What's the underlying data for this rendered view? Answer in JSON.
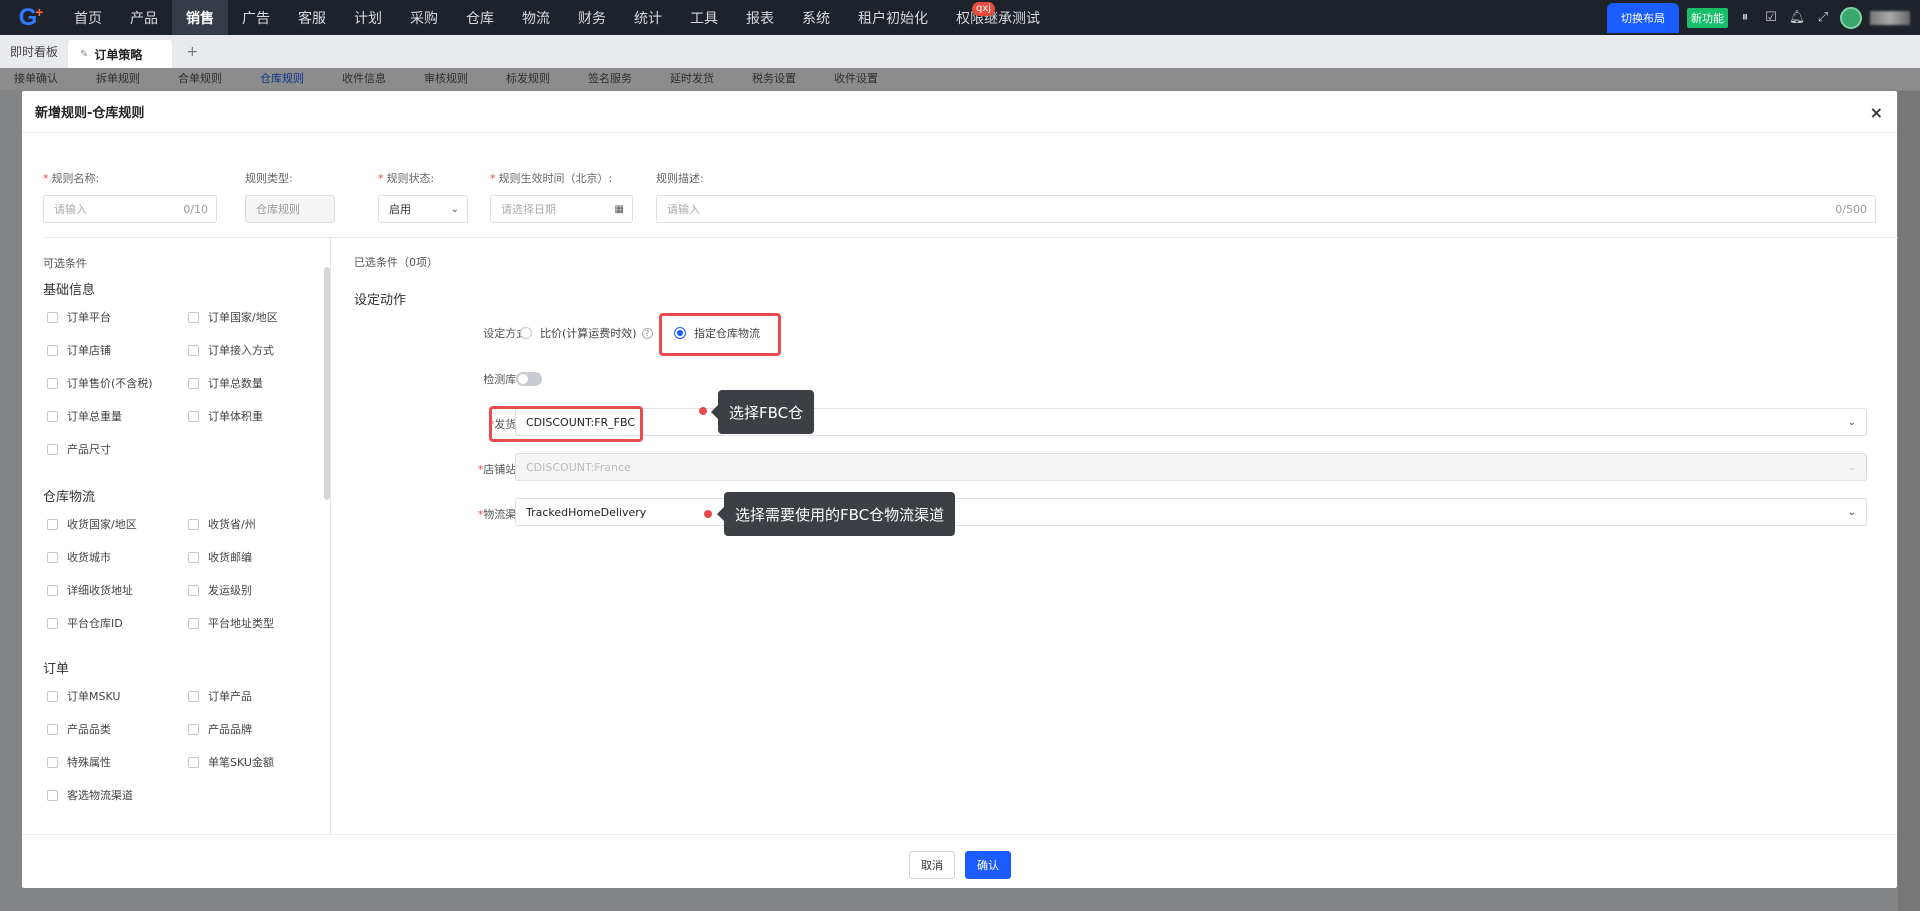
{
  "top_nav": {
    "items": [
      "首页",
      "产品",
      "销售",
      "广告",
      "客服",
      "计划",
      "采购",
      "仓库",
      "物流",
      "财务",
      "统计",
      "工具",
      "报表",
      "系统",
      "租户初始化",
      "权限继承测试"
    ],
    "active_index": 2,
    "badge": "qxj",
    "layout_button": "切换布局",
    "new_feature": "新功能"
  },
  "tabs": {
    "home_tab": "即时看板",
    "active_tab": "订单策略",
    "add": "+"
  },
  "page_subtabs": [
    "接单确认",
    "拆单规则",
    "合单规则",
    "仓库规则",
    "收件信息",
    "审核规则",
    "标发规则",
    "签名服务",
    "延时发货",
    "税务设置",
    "收件设置"
  ],
  "modal": {
    "title": "新增规则-仓库规则",
    "close": "×",
    "form": {
      "name_label": "规则名称:",
      "name_placeholder": "请输入",
      "name_count": "0/10",
      "type_label": "规则类型:",
      "type_value": "仓库规则",
      "status_label": "规则状态:",
      "status_value": "启用",
      "time_label": "规则生效时间（北京）:",
      "time_placeholder": "请选择日期",
      "desc_label": "规则描述:",
      "desc_placeholder": "请输入",
      "desc_count": "0/500"
    },
    "left_panel": {
      "title": "可选条件",
      "groups": [
        {
          "title": "基础信息",
          "items": [
            "订单平台",
            "订单国家/地区",
            "订单店铺",
            "订单接入方式",
            "订单售价(不含税)",
            "订单总数量",
            "订单总重量",
            "订单体积重",
            "产品尺寸"
          ]
        },
        {
          "title": "仓库物流",
          "items": [
            "收货国家/地区",
            "收货省/州",
            "收货城市",
            "收货邮编",
            "详细收货地址",
            "发运级别",
            "平台仓库ID",
            "平台地址类型"
          ]
        },
        {
          "title": "订单",
          "items": [
            "订单MSKU",
            "订单产品",
            "产品品类",
            "产品品牌",
            "特殊属性",
            "单笔SKU金额",
            "客选物流渠道"
          ]
        }
      ]
    },
    "right_panel": {
      "selected": "已选条件（0项）",
      "action_title": "设定动作",
      "mode_label": "设定方式:",
      "mode_option_1": "比价(计算运费时效)",
      "mode_option_2": "指定仓库物流",
      "check_stock_label": "检测库存:",
      "warehouse_label": "发货仓:",
      "warehouse_value": "CDISCOUNT:FR_FBC",
      "store_label": "店铺站点:",
      "store_value": "CDISCOUNT:France",
      "channel_label": "物流渠道:",
      "channel_value": "TrackedHomeDelivery"
    },
    "annotations": {
      "callout_1": "选择FBC仓",
      "callout_2": "选择需要使用的FBC仓物流渠道"
    },
    "footer": {
      "cancel": "取消",
      "confirm": "确认"
    }
  }
}
